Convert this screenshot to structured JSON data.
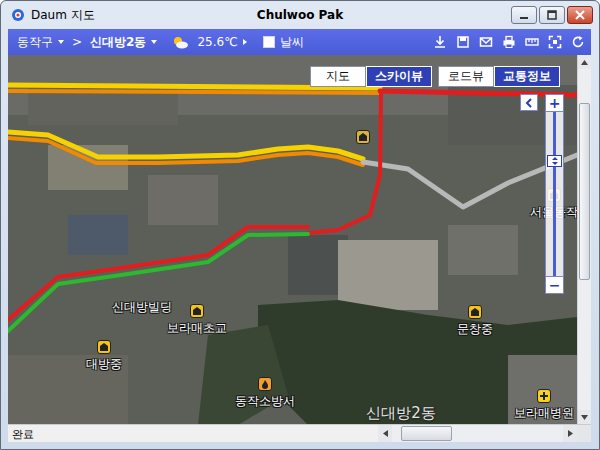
{
  "window": {
    "title": "Daum 지도",
    "user": "Chulwoo Pak"
  },
  "toolbar": {
    "district": "동작구",
    "separator": ">",
    "dong": "신대방2동",
    "temperature": "25.6℃",
    "weather": {
      "label": "날씨",
      "checked": false
    }
  },
  "map_types": [
    {
      "label": "지도",
      "selected": false
    },
    {
      "label": "스카이뷰",
      "selected": true
    }
  ],
  "layers": [
    {
      "label": "로드뷰",
      "on": false
    },
    {
      "label": "교통정보",
      "on": true
    }
  ],
  "zoom": {
    "plus": "+",
    "minus": "−",
    "level": 0.72
  },
  "places": [
    {
      "name": "신대방빌딩",
      "kind": "label"
    },
    {
      "name": "보라매초교",
      "kind": "school"
    },
    {
      "name": "대방중",
      "kind": "school"
    },
    {
      "name": "문창중",
      "kind": "school"
    },
    {
      "name": "서울동작",
      "kind": "office"
    },
    {
      "name": "동작소방서",
      "kind": "fire"
    },
    {
      "name": "보라매병원",
      "kind": "hospital"
    },
    {
      "kind": "landmark"
    }
  ],
  "district_label": "신대방2동",
  "traffic": [
    {
      "color": "#f6d200"
    },
    {
      "color": "#f08a00"
    },
    {
      "color": "#e21d1d"
    },
    {
      "color": "#f6d200"
    },
    {
      "color": "#f08a00"
    },
    {
      "color": "#b8b8b8"
    },
    {
      "color": "#e21d1d"
    },
    {
      "color": "#e21d1d"
    },
    {
      "color": "#2db82d"
    }
  ],
  "status_bar": {
    "text": "완료"
  },
  "scrollbars": {
    "vertical": {
      "offset": 0.1,
      "thumb": 0.52
    },
    "horizontal": {
      "offset": 0.05,
      "thumb": 0.3
    }
  }
}
